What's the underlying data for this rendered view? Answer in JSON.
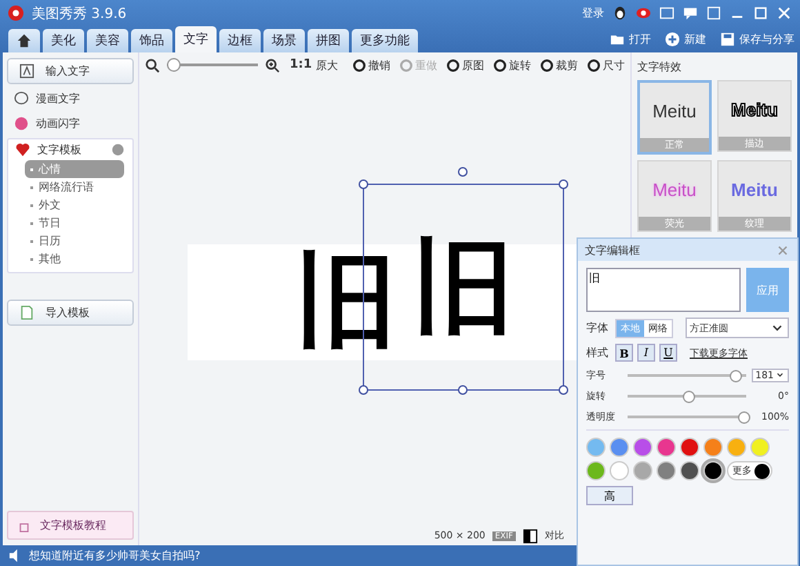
{
  "window": {
    "title": "美图秀秀 3.9.6",
    "login": "登录"
  },
  "tabs": [
    {
      "label": "美化",
      "selected": false
    },
    {
      "label": "美容",
      "selected": false
    },
    {
      "label": "饰品",
      "selected": false
    },
    {
      "label": "文字",
      "selected": true
    },
    {
      "label": "边框",
      "selected": false
    },
    {
      "label": "场景",
      "selected": false
    },
    {
      "label": "拼图",
      "selected": false
    },
    {
      "label": "更多功能",
      "selected": false
    }
  ],
  "top_actions": [
    "打开",
    "新建",
    "保存与分享"
  ],
  "sidebar": {
    "input_button": "输入文字",
    "items": [
      {
        "label": "漫画文字"
      },
      {
        "label": "动画闪字"
      }
    ],
    "templates": {
      "label": "文字模板",
      "expanded": true,
      "children": [
        {
          "label": "心情",
          "selected": true
        },
        {
          "label": "网络流行语",
          "selected": false
        },
        {
          "label": "外文",
          "selected": false
        },
        {
          "label": "节日",
          "selected": false
        },
        {
          "label": "日历",
          "selected": false
        },
        {
          "label": "其他",
          "selected": false
        }
      ]
    },
    "import_button": "导入模板",
    "tutorial_button": "文字模板教程"
  },
  "toolbar": {
    "zoom": {
      "level": 0
    },
    "actual_size": "1:1",
    "actual_label": "原大",
    "actions": [
      {
        "label": "撤销",
        "disabled": false
      },
      {
        "label": "重做",
        "disabled": true
      },
      {
        "label": "原图",
        "disabled": false
      },
      {
        "label": "旋转",
        "disabled": false
      },
      {
        "label": "裁剪",
        "disabled": false
      },
      {
        "label": "尺寸",
        "disabled": false
      }
    ]
  },
  "canvas": {
    "texts": [
      "旧",
      "旧"
    ],
    "size": "500 × 200",
    "exif": "EXIF",
    "compare": "对比"
  },
  "effects": {
    "title": "文字特效",
    "items": [
      {
        "sample": "Meitu",
        "label": "正常",
        "kind": "plain",
        "selected": true
      },
      {
        "sample": "Meitu",
        "label": "描边",
        "kind": "outline",
        "selected": false
      },
      {
        "sample": "Meitu",
        "label": "荧光",
        "kind": "glow",
        "selected": false
      },
      {
        "sample": "Meitu",
        "label": "纹理",
        "kind": "texture",
        "selected": false
      }
    ]
  },
  "editor": {
    "title": "文字编辑框",
    "value": "旧",
    "apply": "应用",
    "font_label": "字体",
    "font_sources": [
      {
        "label": "本地",
        "selected": true
      },
      {
        "label": "网络",
        "selected": false
      }
    ],
    "font_name": "方正准圆",
    "style_label": "样式",
    "styles": [
      {
        "label": "B",
        "on": false
      },
      {
        "label": "I",
        "on": false
      },
      {
        "label": "U",
        "on": false
      }
    ],
    "download_link": "下载更多字体",
    "sliders": [
      {
        "label": "字号",
        "level": 0.93,
        "kind": "select",
        "reading": "181"
      },
      {
        "label": "旋转",
        "level": 0.5,
        "kind": "text",
        "reading": "0°"
      },
      {
        "label": "透明度",
        "level": 1,
        "kind": "text",
        "reading": "100%"
      }
    ],
    "colors": [
      {
        "color": "#74baf0",
        "selected": false
      },
      {
        "color": "#5a8ff0",
        "selected": false
      },
      {
        "color": "#b84ee8",
        "selected": false
      },
      {
        "color": "#e8368f",
        "selected": false
      },
      {
        "color": "#e01010",
        "selected": false
      },
      {
        "color": "#f5801a",
        "selected": false
      },
      {
        "color": "#f8b010",
        "selected": false
      },
      {
        "color": "#f0f020",
        "selected": false
      },
      {
        "color": "#6cb81c",
        "selected": false
      },
      {
        "color": "#ffffff",
        "selected": false
      },
      {
        "color": "#a8a8a8",
        "selected": false
      },
      {
        "color": "#808080",
        "selected": false
      },
      {
        "color": "#505050",
        "selected": false
      },
      {
        "color": "#000000",
        "selected": true
      }
    ],
    "more_colors": "更多",
    "advanced": "高"
  },
  "status_bar": "想知道附近有多少帅哥美女自拍吗?"
}
